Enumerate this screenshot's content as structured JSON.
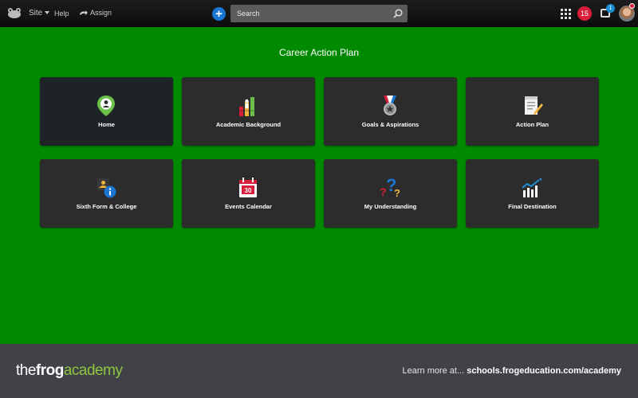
{
  "topbar": {
    "site_label": "Site",
    "help_label": "Help",
    "assign_label": "Assign",
    "search_placeholder": "Search",
    "notification_count": "15",
    "inbox_count": "1"
  },
  "main": {
    "title": "Career Action Plan",
    "tiles": [
      {
        "label": "Home",
        "icon": "home-pin-icon"
      },
      {
        "label": "Academic Background",
        "icon": "bar-chart-icon"
      },
      {
        "label": "Goals & Aspirations",
        "icon": "medal-icon"
      },
      {
        "label": "Action Plan",
        "icon": "document-pencil-icon"
      },
      {
        "label": "Sixth Form & College",
        "icon": "info-icon"
      },
      {
        "label": "Events Calendar",
        "icon": "calendar-icon"
      },
      {
        "label": "My Understanding",
        "icon": "question-marks-icon"
      },
      {
        "label": "Final Destination",
        "icon": "trend-chart-icon"
      }
    ],
    "calendar_day": "30"
  },
  "footer": {
    "brand_the": "the",
    "brand_frog": "frog",
    "brand_academy": "academy",
    "learn_text": "Learn more at... ",
    "learn_url": "schools.frogeducation.com/academy"
  },
  "colors": {
    "background": "#008a00",
    "tile": "#2c2c2c",
    "footer": "#414247",
    "accent_blue": "#1a76d2",
    "badge_red": "#d81e3a"
  }
}
